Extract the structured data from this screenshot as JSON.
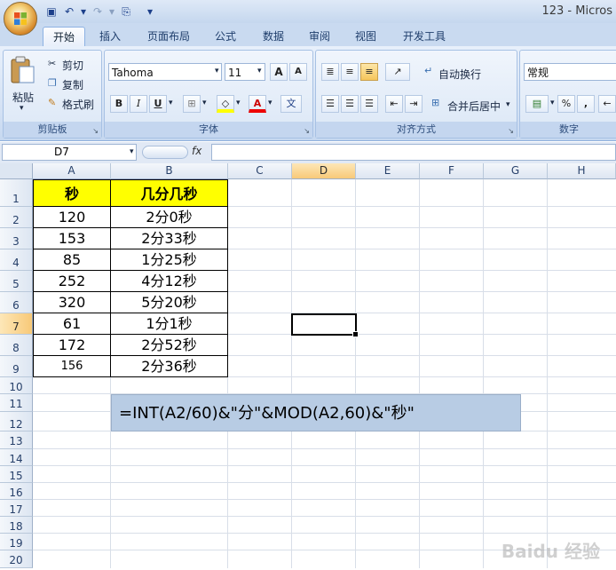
{
  "window": {
    "title": "123 - Micros"
  },
  "ribbon_tabs": [
    "开始",
    "插入",
    "页面布局",
    "公式",
    "数据",
    "审阅",
    "视图",
    "开发工具"
  ],
  "clipboard": {
    "paste": "粘贴",
    "cut": "剪切",
    "copy": "复制",
    "format_painter": "格式刷",
    "label": "剪贴板"
  },
  "font_group": {
    "font_name": "Tahoma",
    "font_size": "11",
    "grow": "A",
    "shrink": "A",
    "bold": "B",
    "italic": "I",
    "underline": "U",
    "font_color_letter": "A",
    "phonetic": "文",
    "label": "字体"
  },
  "alignment_group": {
    "wrap_text": "自动换行",
    "merge_center": "合并后居中",
    "label": "对齐方式"
  },
  "number_group": {
    "format": "常规",
    "percent": "%",
    "comma": ",",
    "label": "数字"
  },
  "name_box": "D7",
  "fx_label": "fx",
  "columns": [
    "A",
    "B",
    "C",
    "D",
    "E",
    "F",
    "G",
    "H"
  ],
  "rows": [
    "1",
    "2",
    "3",
    "4",
    "5",
    "6",
    "7",
    "8",
    "9",
    "10",
    "11",
    "12",
    "13",
    "14",
    "15",
    "16",
    "17",
    "18",
    "19",
    "20"
  ],
  "selected": {
    "column": "D",
    "row": "7"
  },
  "table": {
    "header": [
      "秒",
      "几分几秒"
    ],
    "rows": [
      [
        "120",
        "2分0秒"
      ],
      [
        "153",
        "2分33秒"
      ],
      [
        "85",
        "1分25秒"
      ],
      [
        "252",
        "4分12秒"
      ],
      [
        "320",
        "5分20秒"
      ],
      [
        "61",
        "1分1秒"
      ],
      [
        "172",
        "2分52秒"
      ],
      [
        "156",
        "2分36秒"
      ]
    ]
  },
  "formula_note": "=INT(A2/60)&\"分\"&MOD(A2,60)&\"秒\"",
  "watermark": "Baidu 经验"
}
